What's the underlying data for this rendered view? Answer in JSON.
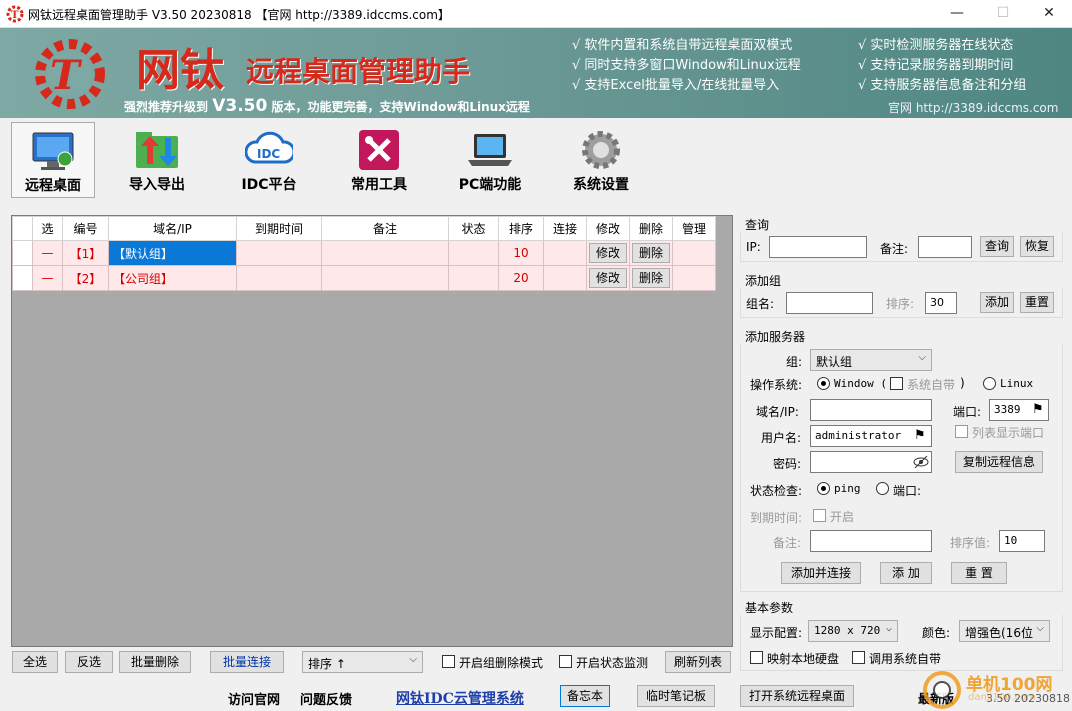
{
  "titlebar": {
    "title": "网钛远程桌面管理助手 V3.50 20230818 【官网 http://3389.idccms.com】",
    "minimize": "—",
    "maximize": "☐",
    "close": "✕"
  },
  "banner": {
    "brand": "网钛",
    "brand_sub": "远程桌面管理助手",
    "slogan_pre": "强烈推荐升级到",
    "slogan_ver": "V3.50",
    "slogan_post": "版本，功能更完善，支持Window和Linux远程",
    "features_left": [
      "√ 软件内置和系统自带远程桌面双模式",
      "√ 同时支持多窗口Window和Linux远程",
      "√ 支持Excel批量导入/在线批量导入"
    ],
    "features_right": [
      "√ 实时检测服务器在线状态",
      "√ 支持记录服务器到期时间",
      "√ 支持服务器信息备注和分组"
    ],
    "site": "官网  http://3389.idccms.com"
  },
  "toolbar": [
    {
      "label": "远程桌面",
      "icon": "monitor-icon"
    },
    {
      "label": "导入导出",
      "icon": "folder-arrows-icon"
    },
    {
      "label": "IDC平台",
      "icon": "idc-cloud-icon"
    },
    {
      "label": "常用工具",
      "icon": "tools-icon"
    },
    {
      "label": "PC端功能",
      "icon": "laptop-icon"
    },
    {
      "label": "系统设置",
      "icon": "gear-icon"
    }
  ],
  "grid": {
    "columns": [
      "选",
      "编号",
      "域名/IP",
      "到期时间",
      "备注",
      "状态",
      "排序",
      "连接",
      "修改",
      "删除",
      "管理"
    ],
    "rows": [
      {
        "sel": "—",
        "id": "【1】",
        "name": "【默认组】",
        "expire": "",
        "note": "",
        "status": "",
        "order": "10",
        "conn": "",
        "edit": "修改",
        "del": "删除",
        "manage": ""
      },
      {
        "sel": "—",
        "id": "【2】",
        "name": "【公司组】",
        "expire": "",
        "note": "",
        "status": "",
        "order": "20",
        "conn": "",
        "edit": "修改",
        "del": "删除",
        "manage": ""
      }
    ]
  },
  "bottom_bar": {
    "select_all": "全选",
    "invert": "反选",
    "batch_delete": "批量删除",
    "batch_connect": "批量连接",
    "sort_value": "排序 ↑",
    "group_delete_mode": "开启组删除模式",
    "status_monitor": "开启状态监测",
    "refresh": "刷新列表"
  },
  "query": {
    "title": "查询",
    "ip_label": "IP:",
    "ip_value": "",
    "note_label": "备注:",
    "note_value": "",
    "query_btn": "查询",
    "reset_btn": "恢复"
  },
  "add_group": {
    "title": "添加组",
    "name_label": "组名:",
    "name_value": "",
    "order_label": "排序:",
    "order_value": "30",
    "add_btn": "添加",
    "reset_btn": "重置"
  },
  "add_server": {
    "title": "添加服务器",
    "group_label": "组:",
    "group_value": "默认组",
    "os_label": "操作系统:",
    "os_window": "Window (",
    "os_system": "系统自带",
    "os_close": ")",
    "os_linux": "Linux",
    "host_label": "域名/IP:",
    "host_value": "",
    "port_label": "端口:",
    "port_value": "3389",
    "user_label": "用户名:",
    "user_value": "administrator",
    "show_port": "列表显示端口",
    "pwd_label": "密码:",
    "pwd_value": "",
    "copy_btn": "复制远程信息",
    "check_label": "状态检查:",
    "check_ping": "ping",
    "check_port": "端口:",
    "expire_label": "到期时间:",
    "expire_enable": "开启",
    "note_label": "备注:",
    "note_value": "",
    "order_label": "排序值:",
    "order_value": "10",
    "add_connect_btn": "添加并连接",
    "add_btn": "添 加",
    "reset_btn": "重 置"
  },
  "basic": {
    "title": "基本参数",
    "res_label": "显示配置:",
    "res_value": "1280 x 720",
    "color_label": "颜色:",
    "color_value": "增强色(16位",
    "map_disk": "映射本地硬盘",
    "use_system": "调用系统自带"
  },
  "footer": {
    "visit_site": "访问官网",
    "feedback": "问题反馈",
    "cloud_system": "网钛IDC云管理系统",
    "memo_btn": "备忘本",
    "notepad_btn": "临时笔记板",
    "open_rdp_btn": "打开系统远程桌面",
    "latest": "最新版",
    "version": "3.50 20230818"
  },
  "watermark": {
    "text": "单机100网",
    "url": "danji100.com"
  },
  "colors": {
    "accent_red": "#d6281b",
    "selection_blue": "#0a78d7",
    "row_pink": "#ffe8ea",
    "banner_teal": "#6f9c98"
  }
}
